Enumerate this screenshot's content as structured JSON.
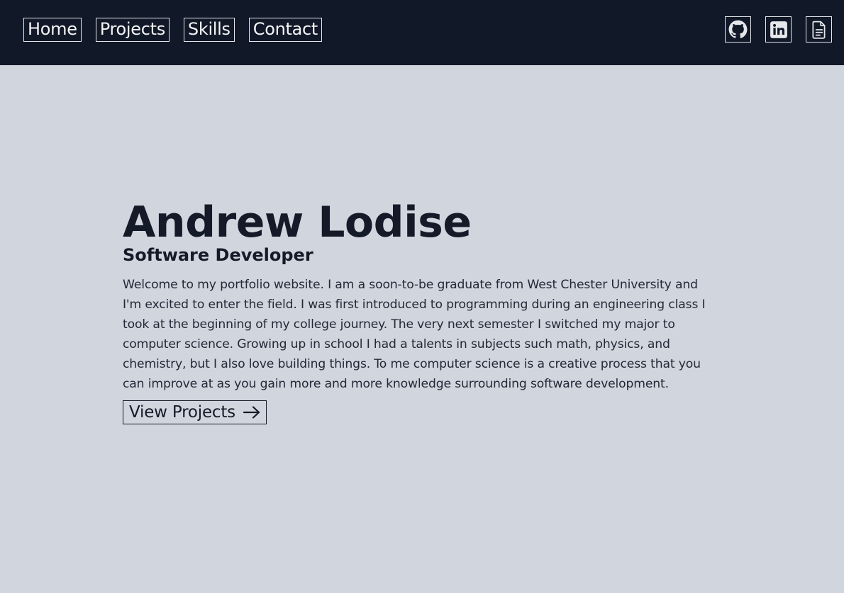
{
  "nav": {
    "links": [
      {
        "label": "Home"
      },
      {
        "label": "Projects"
      },
      {
        "label": "Skills"
      },
      {
        "label": "Contact"
      }
    ],
    "icons": [
      {
        "name": "github-icon"
      },
      {
        "name": "linkedin-icon"
      },
      {
        "name": "resume-document-icon"
      }
    ]
  },
  "hero": {
    "name": "Andrew Lodise",
    "role": "Software Developer",
    "bio": "Welcome to my portfolio website. I am a soon-to-be graduate from West Chester University and I'm excited to enter the field. I was first introduced to programming during an engineering class I took at the beginning of my college journey. The very next semester I switched my major to computer science. Growing up in school I had a talents in subjects such math, physics, and chemistry, but I also love building things. To me computer science is a creative process that you can improve at as you gain more and more knowledge surrounding software development.",
    "cta_label": "View Projects"
  },
  "colors": {
    "nav_bg": "#111827",
    "page_bg": "#d1d5de",
    "text_dark": "#141a28"
  }
}
